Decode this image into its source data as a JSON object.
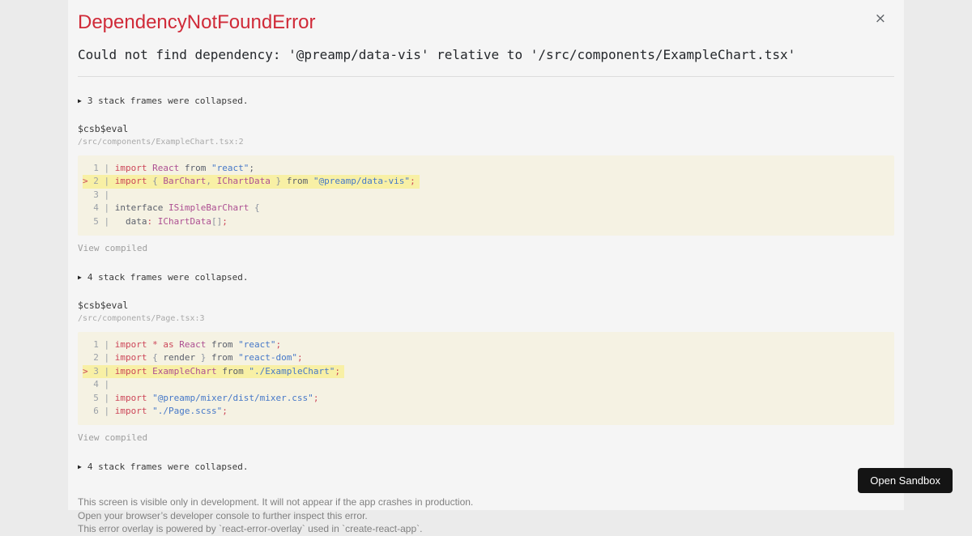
{
  "colors": {
    "page_bg": "#ebebeb",
    "panel_bg": "#f5f5f5",
    "title_red": "#d02a38",
    "kw": "#cc4659",
    "cls": "#ad4f92",
    "str": "#4678c8",
    "pl": "#5a5f6b",
    "pun": "#8b93a0",
    "gutter": "#9ba1a8",
    "code_bg": "#f5f2e3",
    "hl_bg": "#f8f0a5",
    "text_dark": "#24272b",
    "text_mid": "#3a3a3a",
    "text_light": "#a9a9a9",
    "footer_text": "#818181",
    "divider": "#dcdcdc",
    "button_bg": "#141414",
    "button_text": "#ffffff",
    "close": "#5f6368"
  },
  "icons": {
    "close": "×",
    "collapse_triangle": "▶"
  },
  "header": {
    "title": "DependencyNotFoundError"
  },
  "error_message": "Could not find dependency: '@preamp/data-vis' relative to '/src/components/ExampleChart.tsx'",
  "frames": [
    {
      "collapsed_label": "3 stack frames were collapsed.",
      "function_name": "$csb$eval",
      "location": "/src/components/ExampleChart.tsx:2",
      "view_compiled_label": "View compiled",
      "code": {
        "highlight_line": 2,
        "lines": [
          {
            "num": 1,
            "highlight": false,
            "tokens": [
              [
                "kw",
                "import"
              ],
              [
                "pl",
                " "
              ],
              [
                "cls",
                "React"
              ],
              [
                "pl",
                " from "
              ],
              [
                "str",
                "\"react\""
              ],
              [
                "pl",
                ";"
              ]
            ]
          },
          {
            "num": 2,
            "highlight": true,
            "tokens": [
              [
                "kw",
                "import"
              ],
              [
                "pl",
                " "
              ],
              [
                "pun",
                "{"
              ],
              [
                "pl",
                " "
              ],
              [
                "cls",
                "BarChart"
              ],
              [
                "pun",
                ","
              ],
              [
                "pl",
                " "
              ],
              [
                "cls",
                "IChartData"
              ],
              [
                "pl",
                " "
              ],
              [
                "pun",
                "}"
              ],
              [
                "pl",
                " from "
              ],
              [
                "str",
                "\"@preamp/data-vis\""
              ],
              [
                "kw",
                ";"
              ]
            ]
          },
          {
            "num": 3,
            "highlight": false,
            "tokens": []
          },
          {
            "num": 4,
            "highlight": false,
            "tokens": [
              [
                "pl",
                "interface "
              ],
              [
                "cls",
                "ISimpleBarChart"
              ],
              [
                "pl",
                " "
              ],
              [
                "pun",
                "{"
              ]
            ]
          },
          {
            "num": 5,
            "highlight": false,
            "tokens": [
              [
                "pl",
                "  data"
              ],
              [
                "kw",
                ":"
              ],
              [
                "pl",
                " "
              ],
              [
                "cls",
                "IChartData"
              ],
              [
                "pun",
                "[]"
              ],
              [
                "kw",
                ";"
              ]
            ]
          }
        ]
      }
    },
    {
      "collapsed_label": "4 stack frames were collapsed.",
      "function_name": "$csb$eval",
      "location": "/src/components/Page.tsx:3",
      "view_compiled_label": "View compiled",
      "code": {
        "highlight_line": 3,
        "lines": [
          {
            "num": 1,
            "highlight": false,
            "tokens": [
              [
                "kw",
                "import"
              ],
              [
                "pl",
                " "
              ],
              [
                "kw",
                "*"
              ],
              [
                "pl",
                " "
              ],
              [
                "kw",
                "as"
              ],
              [
                "pl",
                " "
              ],
              [
                "cls",
                "React"
              ],
              [
                "pl",
                " from "
              ],
              [
                "str",
                "\"react\""
              ],
              [
                "kw",
                ";"
              ]
            ]
          },
          {
            "num": 2,
            "highlight": false,
            "tokens": [
              [
                "kw",
                "import"
              ],
              [
                "pl",
                " "
              ],
              [
                "pun",
                "{"
              ],
              [
                "pl",
                " render "
              ],
              [
                "pun",
                "}"
              ],
              [
                "pl",
                " from "
              ],
              [
                "str",
                "\"react-dom\""
              ],
              [
                "kw",
                ";"
              ]
            ]
          },
          {
            "num": 3,
            "highlight": true,
            "tokens": [
              [
                "kw",
                "import"
              ],
              [
                "pl",
                " "
              ],
              [
                "cls",
                "ExampleChart"
              ],
              [
                "pl",
                " from "
              ],
              [
                "str",
                "\"./ExampleChart\""
              ],
              [
                "kw",
                ";"
              ]
            ]
          },
          {
            "num": 4,
            "highlight": false,
            "tokens": []
          },
          {
            "num": 5,
            "highlight": false,
            "tokens": [
              [
                "kw",
                "import"
              ],
              [
                "pl",
                " "
              ],
              [
                "str",
                "\"@preamp/mixer/dist/mixer.css\""
              ],
              [
                "kw",
                ";"
              ]
            ]
          },
          {
            "num": 6,
            "highlight": false,
            "tokens": [
              [
                "kw",
                "import"
              ],
              [
                "pl",
                " "
              ],
              [
                "str",
                "\"./Page.scss\""
              ],
              [
                "kw",
                ";"
              ]
            ]
          }
        ]
      }
    },
    {
      "collapsed_label": "4 stack frames were collapsed."
    }
  ],
  "footer": {
    "lines": [
      "This screen is visible only in development. It will not appear if the app crashes in production.",
      "Open your browser’s developer console to further inspect this error.",
      "This error overlay is powered by `react-error-overlay` used in `create-react-app`."
    ],
    "open_sandbox_label": "Open Sandbox"
  }
}
